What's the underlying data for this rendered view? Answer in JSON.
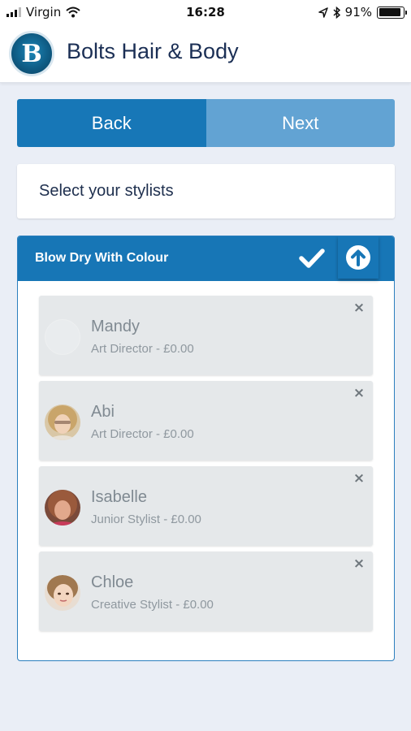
{
  "status_bar": {
    "carrier": "Virgin",
    "time": "16:28",
    "battery": "91%",
    "battery_level": 0.91,
    "icons": [
      "signal-icon",
      "wifi-icon",
      "location-arrow-icon",
      "bluetooth-icon",
      "battery-icon"
    ]
  },
  "header": {
    "logo_letter": "B",
    "title": "Bolts Hair & Body"
  },
  "nav": {
    "back_label": "Back",
    "next_label": "Next"
  },
  "prompt": {
    "text": "Select your stylists"
  },
  "service": {
    "name": "Blow Dry With Colour",
    "icons": [
      "check-icon",
      "arrow-up-circle-icon"
    ]
  },
  "stylists": [
    {
      "name": "Mandy",
      "role": "Art Director - £0.00",
      "remove": "×"
    },
    {
      "name": "Abi",
      "role": "Art Director - £0.00",
      "remove": "×"
    },
    {
      "name": "Isabelle",
      "role": "Junior Stylist - £0.00",
      "remove": "×"
    },
    {
      "name": "Chloe",
      "role": "Creative Stylist - £0.00",
      "remove": "×"
    }
  ],
  "colors": {
    "primary": "#1776b6",
    "next_button": "#62a3d3",
    "page_bg": "#eaeef6",
    "card_bg": "#e5e8ea",
    "title_text": "#1b2f55"
  }
}
